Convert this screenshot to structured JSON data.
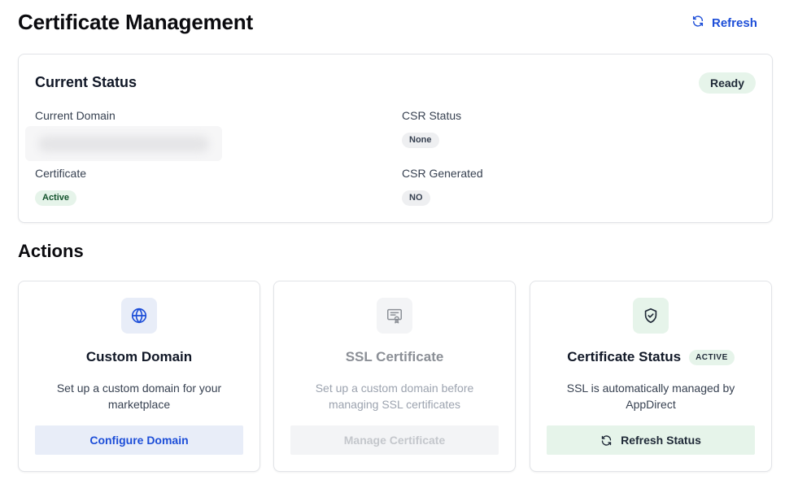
{
  "header": {
    "title": "Certificate Management",
    "refresh_label": "Refresh"
  },
  "status": {
    "title": "Current Status",
    "badge": "Ready",
    "current_domain_label": "Current Domain",
    "current_domain_value": "",
    "csr_status_label": "CSR Status",
    "csr_status_value": "None",
    "certificate_label": "Certificate",
    "certificate_value": "Active",
    "csr_generated_label": "CSR Generated",
    "csr_generated_value": "NO"
  },
  "actions": {
    "title": "Actions",
    "cards": [
      {
        "icon": "globe-icon",
        "title": "Custom Domain",
        "description": "Set up a custom domain for your marketplace",
        "button": "Configure Domain",
        "accent": "#1d4ed8",
        "tile_bg": "#e8edf8",
        "button_bg": "#e8edf8"
      },
      {
        "icon": "certificate-icon",
        "title": "SSL Certificate",
        "description": "Set up a custom domain before managing SSL certificates",
        "button": "Manage Certificate",
        "accent": "#9ca3af",
        "tile_bg": "#f3f4f6",
        "button_bg": "#f3f4f6"
      },
      {
        "icon": "shield-check-icon",
        "title": "Certificate Status",
        "badge": "ACTIVE",
        "description": "SSL is automatically managed by AppDirect",
        "button": "Refresh Status",
        "accent": "#1f2937",
        "tile_bg": "#e6f4ea",
        "button_bg": "#e6f4ea"
      }
    ]
  }
}
